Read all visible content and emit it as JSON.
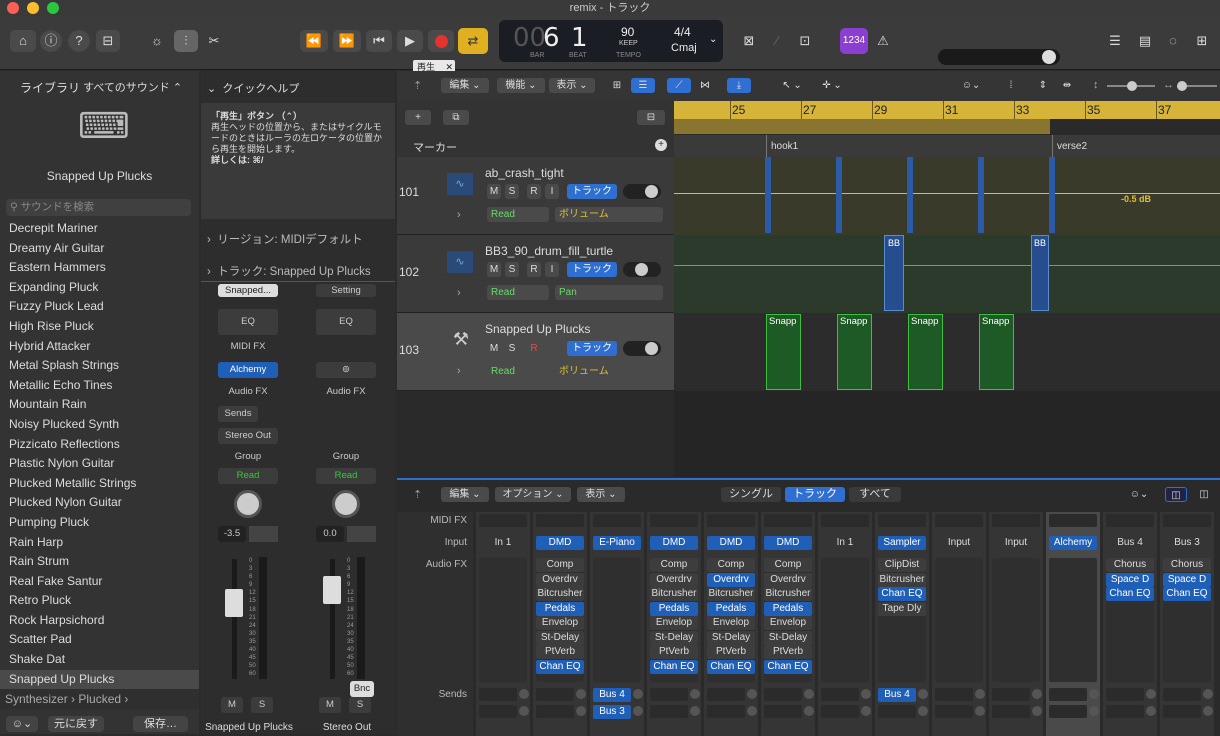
{
  "window": {
    "title": "remix - トラック",
    "tooltip": "再生"
  },
  "lcd": {
    "bar_prefix": "00",
    "bar": "6",
    "beat": "1",
    "bar_label": "BAR",
    "beat_label": "BEAT",
    "tempo": "90",
    "keep": "KEEP",
    "tempo_label": "TEMPO",
    "timesig": "4/4",
    "key": "Cmaj"
  },
  "toolbar": {
    "count_in": "1234"
  },
  "library": {
    "header_left": "ライブラリ",
    "header_right": "すべてのサウンド ⌃",
    "patch_name": "Snapped Up Plucks",
    "search_placeholder": "サウンドを検索",
    "items": [
      "Decrepit Mariner",
      "Dreamy Air Guitar",
      "Eastern Hammers",
      "Expanding Pluck",
      "Fuzzy Pluck Lead",
      "High Rise Pluck",
      "Hybrid Attacker",
      "Metal Splash Strings",
      "Metallic Echo Tines",
      "Mountain Rain",
      "Noisy Plucked Synth",
      "Pizzicato Reflections",
      "Plastic Nylon Guitar",
      "Plucked Metallic Strings",
      "Plucked Nylon Guitar",
      "Pumping Pluck",
      "Rain Harp",
      "Rain Strum",
      "Real Fake Santur",
      "Retro Pluck",
      "Rock Harpsichord",
      "Scatter Pad",
      "Shake Dat",
      "Snapped Up Plucks"
    ],
    "breadcrumb": "Synthesizer › Plucked ›",
    "revert": "元に戻す",
    "save": "保存…"
  },
  "quickhelp": {
    "title": "クイックヘルプ",
    "heading": "「再生」ボタン （⌃）",
    "body": "再生ヘッドの位置から、またはサイクルモードのときはルーラの左ロケータの位置から再生を開始します。",
    "more": "詳しくは: ⌘/",
    "region": "リージョン: MIDIデフォルト",
    "track": "トラック: Snapped Up Plucks"
  },
  "inspector": {
    "ch1": {
      "setting": "Snapped...",
      "eq": "EQ",
      "midifx": "MIDI FX",
      "instrument": "Alchemy",
      "audiofx": "Audio FX",
      "sends": "Sends",
      "output": "Stereo Out",
      "group": "Group",
      "read": "Read",
      "value": "-3.5",
      "m": "M",
      "s": "S",
      "name": "Snapped Up Plucks"
    },
    "ch2": {
      "setting": "Setting",
      "eq": "EQ",
      "audiofx": "Audio FX",
      "group": "Group",
      "read": "Read",
      "value": "0.0",
      "bnc": "Bnc",
      "m": "M",
      "s": "S",
      "name": "Stereo Out"
    },
    "scale": [
      "0",
      "3",
      "6",
      "9",
      "12",
      "15",
      "18",
      "21",
      "24",
      "30",
      "35",
      "40",
      "45",
      "50",
      "60"
    ]
  },
  "tracks_toolbar": {
    "edit": "編集",
    "func": "機能",
    "view": "表示"
  },
  "ruler": {
    "bars": [
      "25",
      "27",
      "29",
      "31",
      "33",
      "35",
      "37"
    ],
    "marker_label": "マーカー",
    "markers": [
      "hook1",
      "verse2"
    ]
  },
  "tracks": [
    {
      "num": "101",
      "name": "ab_crash_tight",
      "mode": "Read",
      "param": "ボリューム",
      "track_btn": "トラック",
      "db": "-0.5 dB"
    },
    {
      "num": "102",
      "name": "BB3_90_drum_fill_turtle",
      "mode": "Read",
      "param": "Pan",
      "track_btn": "トラック",
      "region": "BB"
    },
    {
      "num": "103",
      "name": "Snapped Up Plucks",
      "mode": "Read",
      "param": "ボリューム",
      "track_btn": "トラック",
      "region": "Snapp"
    }
  ],
  "mixer": {
    "edit": "編集",
    "options": "オプション",
    "view": "表示",
    "single": "シングル",
    "tracks": "トラック",
    "all": "すべて",
    "row_midifx": "MIDI FX",
    "row_input": "Input",
    "row_audiofx": "Audio FX",
    "row_sends": "Sends",
    "inputs": [
      "In 1",
      "DMD",
      "E-Piano",
      "DMD",
      "DMD",
      "DMD",
      "In 1",
      "Sampler",
      "Input",
      "Input",
      "Alchemy",
      "Bus 4",
      "Bus 3"
    ],
    "fx": [
      [],
      [
        "Comp",
        "Overdrv",
        "Bitcrusher",
        "Pedals",
        "Envelop",
        "St-Delay",
        "PtVerb",
        "Chan EQ"
      ],
      [],
      [
        "Comp",
        "Overdrv",
        "Bitcrusher",
        "Pedals",
        "Envelop",
        "St-Delay",
        "PtVerb",
        "Chan EQ"
      ],
      [
        "Comp",
        "Overdrv",
        "Bitcrusher",
        "Pedals",
        "Envelop",
        "St-Delay",
        "PtVerb",
        "Chan EQ"
      ],
      [
        "Comp",
        "Overdrv",
        "Bitcrusher",
        "Pedals",
        "Envelop",
        "St-Delay",
        "PtVerb",
        "Chan EQ"
      ],
      [],
      [
        "ClipDist",
        "Bitcrusher",
        "Chan EQ",
        "Tape Dly"
      ],
      [],
      [],
      [],
      [
        "Chorus",
        "Space D",
        "Chan EQ"
      ],
      [
        "Chorus",
        "Space D",
        "Chan EQ"
      ]
    ],
    "sends": {
      "col2": [
        "Bus 4",
        "Bus 3"
      ],
      "col7": [
        "Bus 4"
      ]
    }
  },
  "colors": {
    "accent": "#2f6fd1",
    "yellow": "#e0c030",
    "green": "#2fae3a"
  }
}
